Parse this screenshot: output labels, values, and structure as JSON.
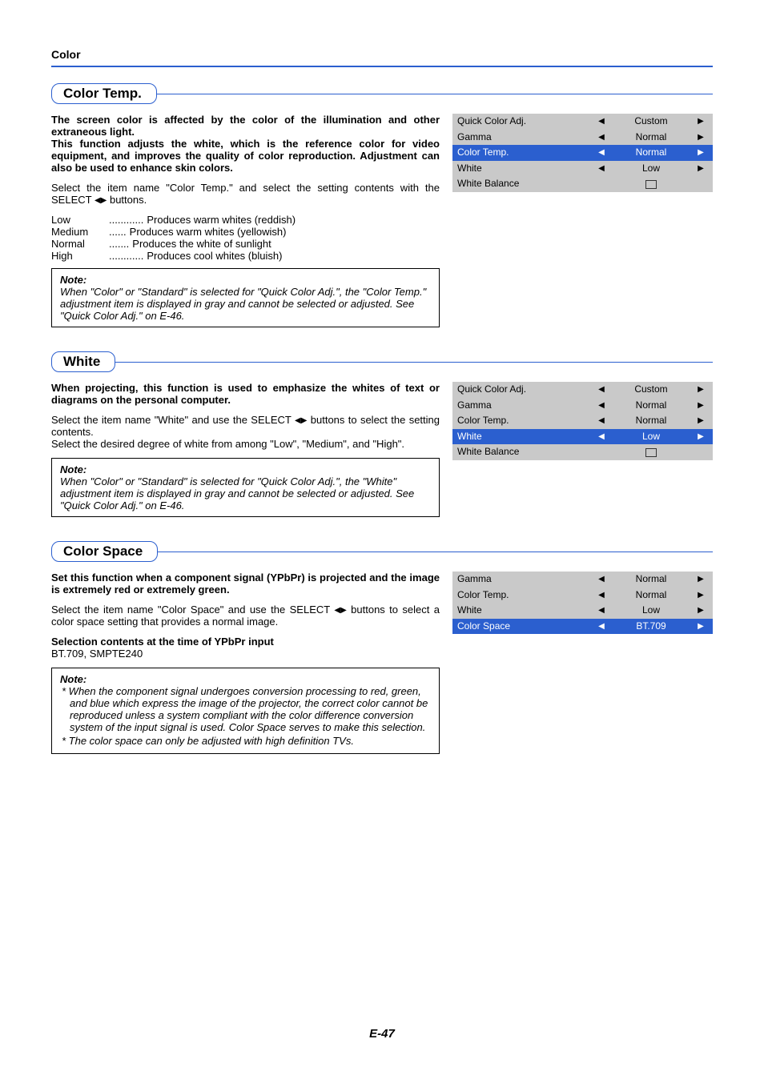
{
  "header": "Color",
  "page_number": "E-47",
  "sections": {
    "color_temp": {
      "title": "Color Temp.",
      "intro": "The screen color is affected by the color of the illumination and other extraneous light.\nThis function adjusts the white, which is the reference color for video equipment, and improves the quality of color reproduction. Adjustment can also be used to enhance skin colors.",
      "instr_pre": "Select the item name \"Color Temp.\" and select the setting contents with the SELECT ",
      "instr_post": " buttons.",
      "options": [
        {
          "term": "Low",
          "dots": "............",
          "desc": "Produces warm whites (reddish)"
        },
        {
          "term": "Medium",
          "dots": "......",
          "desc": "Produces warm whites (yellowish)"
        },
        {
          "term": "Normal",
          "dots": ".......",
          "desc": "Produces the white of sunlight"
        },
        {
          "term": "High",
          "dots": "............",
          "desc": "Produces cool whites (bluish)"
        }
      ],
      "note_label": "Note:",
      "note": "When \"Color\" or \"Standard\" is selected for \"Quick Color Adj.\", the \"Color Temp.\" adjustment item is displayed in gray and cannot be selected or adjusted. See \"Quick Color Adj.\" on E-46.",
      "menu": [
        {
          "label": "Quick Color Adj.",
          "value": "Custom",
          "sel": false,
          "arrows": true
        },
        {
          "label": "Gamma",
          "value": "Normal",
          "sel": false,
          "arrows": true
        },
        {
          "label": "Color Temp.",
          "value": "Normal",
          "sel": true,
          "arrows": true
        },
        {
          "label": "White",
          "value": "Low",
          "sel": false,
          "arrows": true
        },
        {
          "label": "White Balance",
          "value": "enter",
          "sel": false,
          "arrows": false
        }
      ]
    },
    "white": {
      "title": "White",
      "intro": "When projecting, this function is used to emphasize the whites of text or diagrams on the personal computer.",
      "instr_pre": "Select the item name \"White\" and use the SELECT ",
      "instr_post": " buttons to select the setting contents.",
      "line3": "Select the desired degree of white from among \"Low\", \"Medium\", and \"High\".",
      "note_label": "Note:",
      "note": "When \"Color\" or \"Standard\" is selected for \"Quick Color Adj.\", the \"White\" adjustment item is displayed in gray and cannot be selected or adjusted. See \"Quick Color Adj.\" on E-46.",
      "menu": [
        {
          "label": "Quick Color Adj.",
          "value": "Custom",
          "sel": false,
          "arrows": true
        },
        {
          "label": "Gamma",
          "value": "Normal",
          "sel": false,
          "arrows": true
        },
        {
          "label": "Color Temp.",
          "value": "Normal",
          "sel": false,
          "arrows": true
        },
        {
          "label": "White",
          "value": "Low",
          "sel": true,
          "arrows": true
        },
        {
          "label": "White Balance",
          "value": "enter",
          "sel": false,
          "arrows": false
        }
      ]
    },
    "color_space": {
      "title": "Color Space",
      "intro": "Set this function when a component signal (YPbPr) is projected and the image is extremely red or extremely green.",
      "instr_pre": "Select the item name \"Color Space\" and use the SELECT ",
      "instr_post": " buttons to select a color space setting that provides a normal image.",
      "sub_head": "Selection contents at the time of YPbPr input",
      "sub_body": "BT.709, SMPTE240",
      "note_label": "Note:",
      "note1": "When the component signal undergoes conversion processing to red, green, and blue which express the image of the projector, the correct color cannot be reproduced unless a system compliant with the color difference conversion system of the input signal is used. Color Space serves to make this selection.",
      "note2": "The color space can only be adjusted with high definition TVs.",
      "menu": [
        {
          "label": "Gamma",
          "value": "Normal",
          "sel": false,
          "arrows": true
        },
        {
          "label": "Color Temp.",
          "value": "Normal",
          "sel": false,
          "arrows": true
        },
        {
          "label": "White",
          "value": "Low",
          "sel": false,
          "arrows": true
        },
        {
          "label": "Color Space",
          "value": "BT.709",
          "sel": true,
          "arrows": true
        }
      ]
    }
  }
}
